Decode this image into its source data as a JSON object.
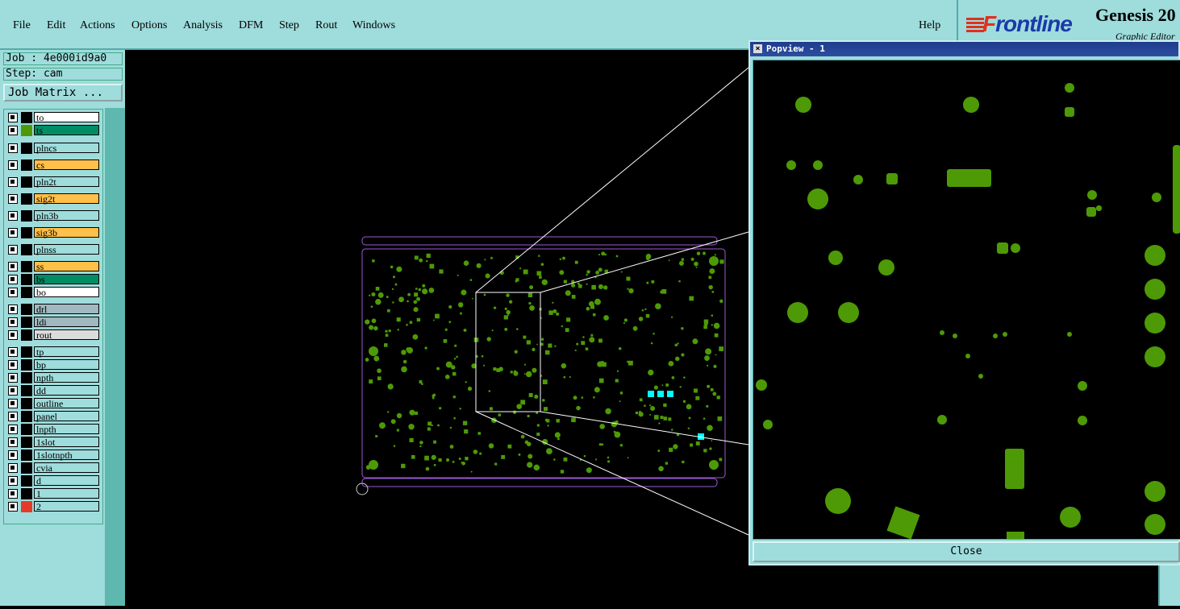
{
  "menu": {
    "items": [
      "File",
      "Edit",
      "Actions",
      "Options",
      "Analysis",
      "DFM",
      "Step",
      "Rout",
      "Windows"
    ],
    "help": "Help"
  },
  "brand": {
    "logo_prefix": "F",
    "logo_rest": "rontline",
    "product": "Genesis 20",
    "subtitle": "Graphic Editor"
  },
  "job": {
    "job_label": "Job : 4e000id9a0",
    "step_label": "Step: cam",
    "matrix_button": "Job Matrix ..."
  },
  "layers": [
    {
      "name": "to",
      "color": "#ffffff",
      "swatch": "#000000"
    },
    {
      "name": "ts",
      "color": "#008c64",
      "swatch": "#4e9a06"
    },
    {
      "name": "plncs",
      "color": "#9fdcdc",
      "swatch": "#000000"
    },
    {
      "name": "cs",
      "color": "#ffc04a",
      "swatch": "#000000"
    },
    {
      "name": "pln2t",
      "color": "#9fdcdc",
      "swatch": "#000000"
    },
    {
      "name": "sig2t",
      "color": "#ffc04a",
      "swatch": "#000000"
    },
    {
      "name": "pln3b",
      "color": "#9fdcdc",
      "swatch": "#000000"
    },
    {
      "name": "sig3b",
      "color": "#ffc04a",
      "swatch": "#000000"
    },
    {
      "name": "plnss",
      "color": "#9fdcdc",
      "swatch": "#000000"
    },
    {
      "name": "ss",
      "color": "#ffc04a",
      "swatch": "#000000"
    },
    {
      "name": "bs",
      "color": "#008c64",
      "swatch": "#000000"
    },
    {
      "name": "bo",
      "color": "#ffffff",
      "swatch": "#000000"
    },
    {
      "name": "drl",
      "color": "#a0b8c0",
      "swatch": "#000000"
    },
    {
      "name": "ldi",
      "color": "#a0b8c0",
      "swatch": "#000000"
    },
    {
      "name": "rout",
      "color": "#dcdcdc",
      "swatch": "#000000"
    },
    {
      "name": "tp",
      "color": "#9fdcdc",
      "swatch": "#000000"
    },
    {
      "name": "bp",
      "color": "#9fdcdc",
      "swatch": "#000000"
    },
    {
      "name": "npth",
      "color": "#9fdcdc",
      "swatch": "#000000"
    },
    {
      "name": "dd",
      "color": "#9fdcdc",
      "swatch": "#000000"
    },
    {
      "name": "outline",
      "color": "#9fdcdc",
      "swatch": "#000000"
    },
    {
      "name": "panel",
      "color": "#9fdcdc",
      "swatch": "#000000"
    },
    {
      "name": "lnpth",
      "color": "#9fdcdc",
      "swatch": "#000000"
    },
    {
      "name": "1slot",
      "color": "#9fdcdc",
      "swatch": "#000000"
    },
    {
      "name": "1slotnpth",
      "color": "#9fdcdc",
      "swatch": "#000000"
    },
    {
      "name": "cvia",
      "color": "#9fdcdc",
      "swatch": "#000000"
    },
    {
      "name": "d",
      "color": "#9fdcdc",
      "swatch": "#000000"
    },
    {
      "name": "1",
      "color": "#9fdcdc",
      "swatch": "#000000"
    },
    {
      "name": "2",
      "color": "#9fdcdc",
      "swatch": "#e53a2a"
    }
  ],
  "popview": {
    "title": "Popview - 1",
    "close_label": "Close"
  },
  "colors": {
    "pad": "#4e9a06",
    "highlight": "#00ffff",
    "outline": "#9a5ad0",
    "panel_bg": "#9fdcdc"
  }
}
